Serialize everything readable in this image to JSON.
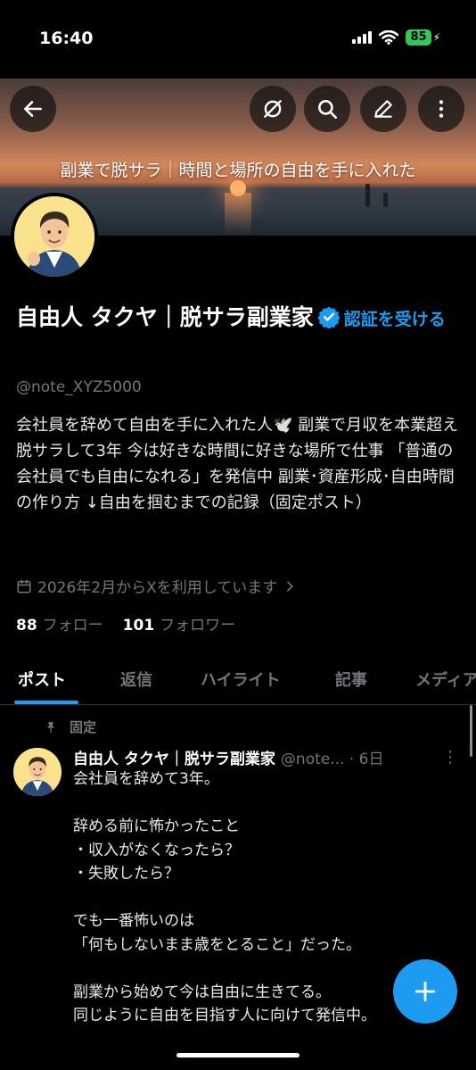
{
  "status_bar": {
    "time": "16:40",
    "battery": "85"
  },
  "banner": {
    "text": "副業で脱サラ｜時間と場所の自由を手に入れた"
  },
  "profile": {
    "name": "自由人 タクヤ｜脱サラ副業家",
    "verify_link": "認証を受ける",
    "handle": "@note_XYZ5000",
    "bio": "会社員を辞めて自由を手に入れた人🕊️ 副業で月収を本業超え 脱サラして3年 今は好きな時間に好きな場所で仕事 「普通の会社員でも自由になれる」を発信中 副業･資産形成･自由時間の作り方 ↓自由を掴むまでの記録（固定ポスト）",
    "joined": "2026年2月からXを利用しています",
    "following_count": "88",
    "following_label": "フォロー",
    "followers_count": "101",
    "followers_label": "フォロワー"
  },
  "tabs": [
    {
      "label": "ポスト",
      "active": true
    },
    {
      "label": "返信",
      "active": false
    },
    {
      "label": "ハイライト",
      "active": false
    },
    {
      "label": "記事",
      "active": false
    },
    {
      "label": "メディア",
      "active": false
    }
  ],
  "tweet": {
    "pinned_label": "固定",
    "author": "自由人 タクヤ｜脱サラ副業家",
    "handle_time": "@note... · 6日",
    "body": "会社員を辞めて3年。\n\n辞める前に怖かったこと\n・収入がなくなったら？\n・失敗したら？\n\nでも一番怖いのは\n「何もしないまま歳をとること」だった。\n\n副業から始めて今は自由に生きてる。\n同じように自由を目指す人に向けて発信中。"
  },
  "colors": {
    "accent": "#1d9bf0",
    "background": "#000000",
    "muted": "#71767b",
    "battery": "#34c759"
  },
  "icons": [
    "back-arrow-icon",
    "grok-icon",
    "search-icon",
    "edit-icon",
    "more-icon",
    "verified-icon",
    "calendar-icon",
    "chevron-right-icon",
    "pin-icon",
    "plus-icon"
  ]
}
